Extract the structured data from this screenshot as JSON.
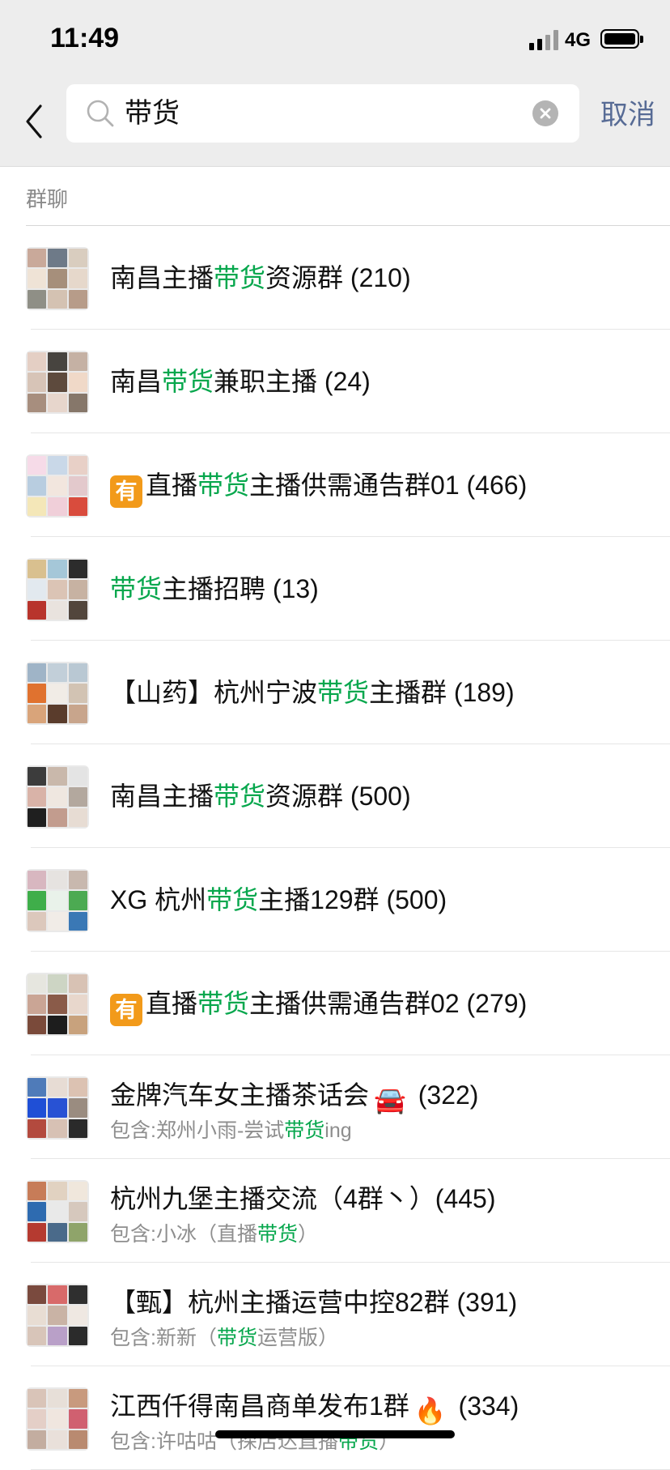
{
  "status": {
    "time": "11:49",
    "network": "4G"
  },
  "search": {
    "query": "带货",
    "cancel_label": "取消"
  },
  "section": {
    "title": "群聊"
  },
  "rows": [
    {
      "segments": [
        {
          "text": "南昌主播",
          "hl": false
        },
        {
          "text": "带货",
          "hl": true
        },
        {
          "text": "资源群 (210)",
          "hl": false
        }
      ],
      "avatar_colors": [
        "#c9a99a",
        "#6e7a88",
        "#d9cdbf",
        "#efe3d6",
        "#a68f7b",
        "#e6d8cb",
        "#8f8f86",
        "#d4c2b2",
        "#b79c89"
      ]
    },
    {
      "segments": [
        {
          "text": "南昌",
          "hl": false
        },
        {
          "text": "带货",
          "hl": true
        },
        {
          "text": "兼职主播 (24)",
          "hl": false
        }
      ],
      "avatar_colors": [
        "#e4cfc4",
        "#47443f",
        "#c5b1a4",
        "#d7c4b7",
        "#5d4a3d",
        "#f0d9c8",
        "#a78e7e",
        "#e7d6cc",
        "#86776a"
      ]
    },
    {
      "badge": "有",
      "segments": [
        {
          "text": "直播",
          "hl": false
        },
        {
          "text": "带货",
          "hl": true
        },
        {
          "text": "主播供需通告群01 (466)",
          "hl": false
        }
      ],
      "avatar_colors": [
        "#f6dbe8",
        "#c9d8e8",
        "#e8d0c7",
        "#b8cde0",
        "#f2e6de",
        "#e3c9cc",
        "#f4e7b8",
        "#f0cfd9",
        "#d94c3d"
      ]
    },
    {
      "segments": [
        {
          "text": "带货",
          "hl": true
        },
        {
          "text": "主播招聘 (13)",
          "hl": false
        }
      ],
      "avatar_colors": [
        "#d9c08f",
        "#a5c7d8",
        "#2c2c2c",
        "#e2e9ef",
        "#dbc4b5",
        "#c7b2a2",
        "#b8342c",
        "#e9e3de",
        "#52463c"
      ]
    },
    {
      "segments": [
        {
          "text": "【山药】杭州宁波",
          "hl": false
        },
        {
          "text": "带货",
          "hl": true
        },
        {
          "text": "主播群 (189)",
          "hl": false
        }
      ],
      "avatar_colors": [
        "#9fb4c7",
        "#c2cfd9",
        "#b9c8d3",
        "#e0722f",
        "#f1ece6",
        "#d2c3b3",
        "#d9a47a",
        "#5a3c2c",
        "#c8a58c"
      ]
    },
    {
      "segments": [
        {
          "text": "南昌主播",
          "hl": false
        },
        {
          "text": "带货",
          "hl": true
        },
        {
          "text": "资源群 (500)",
          "hl": false
        }
      ],
      "avatar_colors": [
        "#3c3c3c",
        "#c9b8ab",
        "#e4e4e4",
        "#d9b3a8",
        "#efe7e0",
        "#b3a89e",
        "#1f1f1f",
        "#c29c8e",
        "#e7dcd3"
      ]
    },
    {
      "segments": [
        {
          "text": "XG 杭州",
          "hl": false
        },
        {
          "text": "带货",
          "hl": true
        },
        {
          "text": "主播129群 (500)",
          "hl": false
        }
      ],
      "avatar_colors": [
        "#d8b7c0",
        "#e6e3e0",
        "#c8b8ae",
        "#3fae4a",
        "#e9f2ea",
        "#4caa52",
        "#dcc8bc",
        "#f1ece7",
        "#3a78b5"
      ]
    },
    {
      "badge": "有",
      "segments": [
        {
          "text": "直播",
          "hl": false
        },
        {
          "text": "带货",
          "hl": true
        },
        {
          "text": "主播供需通告群02 (279)",
          "hl": false
        }
      ],
      "avatar_colors": [
        "#e6e6df",
        "#cdd5c4",
        "#d8c2b4",
        "#caa595",
        "#8a5b49",
        "#e8d7cc",
        "#7a4a3a",
        "#1d1d1d",
        "#c8a27d"
      ]
    },
    {
      "segments": [
        {
          "text": "金牌汽车女主播茶话会",
          "hl": false
        },
        {
          "text": "🚘",
          "emoji": true
        },
        {
          "text": " (322)",
          "hl": false
        }
      ],
      "sub": [
        {
          "text": "包含:郑州小雨-尝试",
          "hl": false
        },
        {
          "text": "带货",
          "hl": true
        },
        {
          "text": "ing",
          "hl": false
        }
      ],
      "avatar_colors": [
        "#4f7bb9",
        "#e7dcd4",
        "#dcc2b2",
        "#1f4fd6",
        "#2852d4",
        "#9a8c80",
        "#b34a3e",
        "#d7c1b4",
        "#2a2a2a"
      ]
    },
    {
      "segments": [
        {
          "text": "杭州九堡主播交流（4群丶）(445)",
          "hl": false
        }
      ],
      "sub": [
        {
          "text": "包含:小冰（直播",
          "hl": false
        },
        {
          "text": "带货",
          "hl": true
        },
        {
          "text": "）",
          "hl": false
        }
      ],
      "avatar_colors": [
        "#c77c58",
        "#e1d2c1",
        "#f0e7dc",
        "#2e6bb0",
        "#e9e9e9",
        "#d6c8bd",
        "#b53a30",
        "#4a6a8a",
        "#8fa46a"
      ]
    },
    {
      "segments": [
        {
          "text": "【甄】杭州主播运营中控82群 (391)",
          "hl": false
        }
      ],
      "sub": [
        {
          "text": "包含:新新（",
          "hl": false
        },
        {
          "text": "带货",
          "hl": true
        },
        {
          "text": "运营版）",
          "hl": false
        }
      ],
      "avatar_colors": [
        "#7a4a3e",
        "#d86a6a",
        "#2f2f2f",
        "#e8ddd3",
        "#c9b3a5",
        "#efe8e2",
        "#d8c5b9",
        "#b9a0c8",
        "#2b2b2b"
      ]
    },
    {
      "segments": [
        {
          "text": "江西仟得南昌商单发布1群",
          "hl": false
        },
        {
          "text": "🔥",
          "emoji": true
        },
        {
          "text": " (334)",
          "hl": false
        }
      ],
      "sub": [
        {
          "text": "包含:许咕咕（探店达直播",
          "hl": false
        },
        {
          "text": "带货",
          "hl": true
        },
        {
          "text": "）",
          "hl": false
        }
      ],
      "avatar_colors": [
        "#d9c4b8",
        "#e7dfd8",
        "#c89a7e",
        "#e4cfc7",
        "#f0e6df",
        "#d06070",
        "#c3ada0",
        "#e9e0da",
        "#b98a70"
      ]
    }
  ]
}
